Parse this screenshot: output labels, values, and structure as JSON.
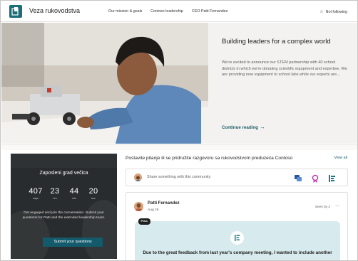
{
  "header": {
    "site_title": "Veza rukovodstva",
    "nav": [
      "Our mission & goals",
      "Contoso leadership",
      "CEO Patti Fernandez"
    ],
    "follow_label": "Not following"
  },
  "hero": {
    "title": "Building leaders for a complex world",
    "description": "We're excited to announce our STEM partnership with 40 school districts in which we're donating scientific equipment and expertise. We are providing new equipment to school labs while our experts are...",
    "link_label": "Continue reading",
    "link_arrow": "→"
  },
  "countdown": {
    "title": "Zaposleni grad večica",
    "cells": [
      {
        "value": "407",
        "unit": "days"
      },
      {
        "value": "23",
        "unit": "hrs"
      },
      {
        "value": "44",
        "unit": "min"
      },
      {
        "value": "20",
        "unit": "sec"
      }
    ],
    "description": "Get engaged and join the conversation. Submit your questions for Patti and the extended leadership team.",
    "button_label": "Submit your questions"
  },
  "community": {
    "title": "Postavite pitanje ili se pridružite razgovoru sa rukovodstvom preduzeća Contoso",
    "view_all": "View all",
    "share_placeholder": "Share something with this community",
    "post": {
      "author": "Patti Fernandez",
      "date": "Aug 26",
      "seen_by": "Seen by 2",
      "more": "...",
      "badge": "POLL",
      "text": "Due to the great feedback from last year's company meeting, I wanted to include another"
    }
  },
  "colors": {
    "accent": "#125a6c",
    "link": "#1b5d68",
    "poll_bg": "#d7eaed"
  }
}
